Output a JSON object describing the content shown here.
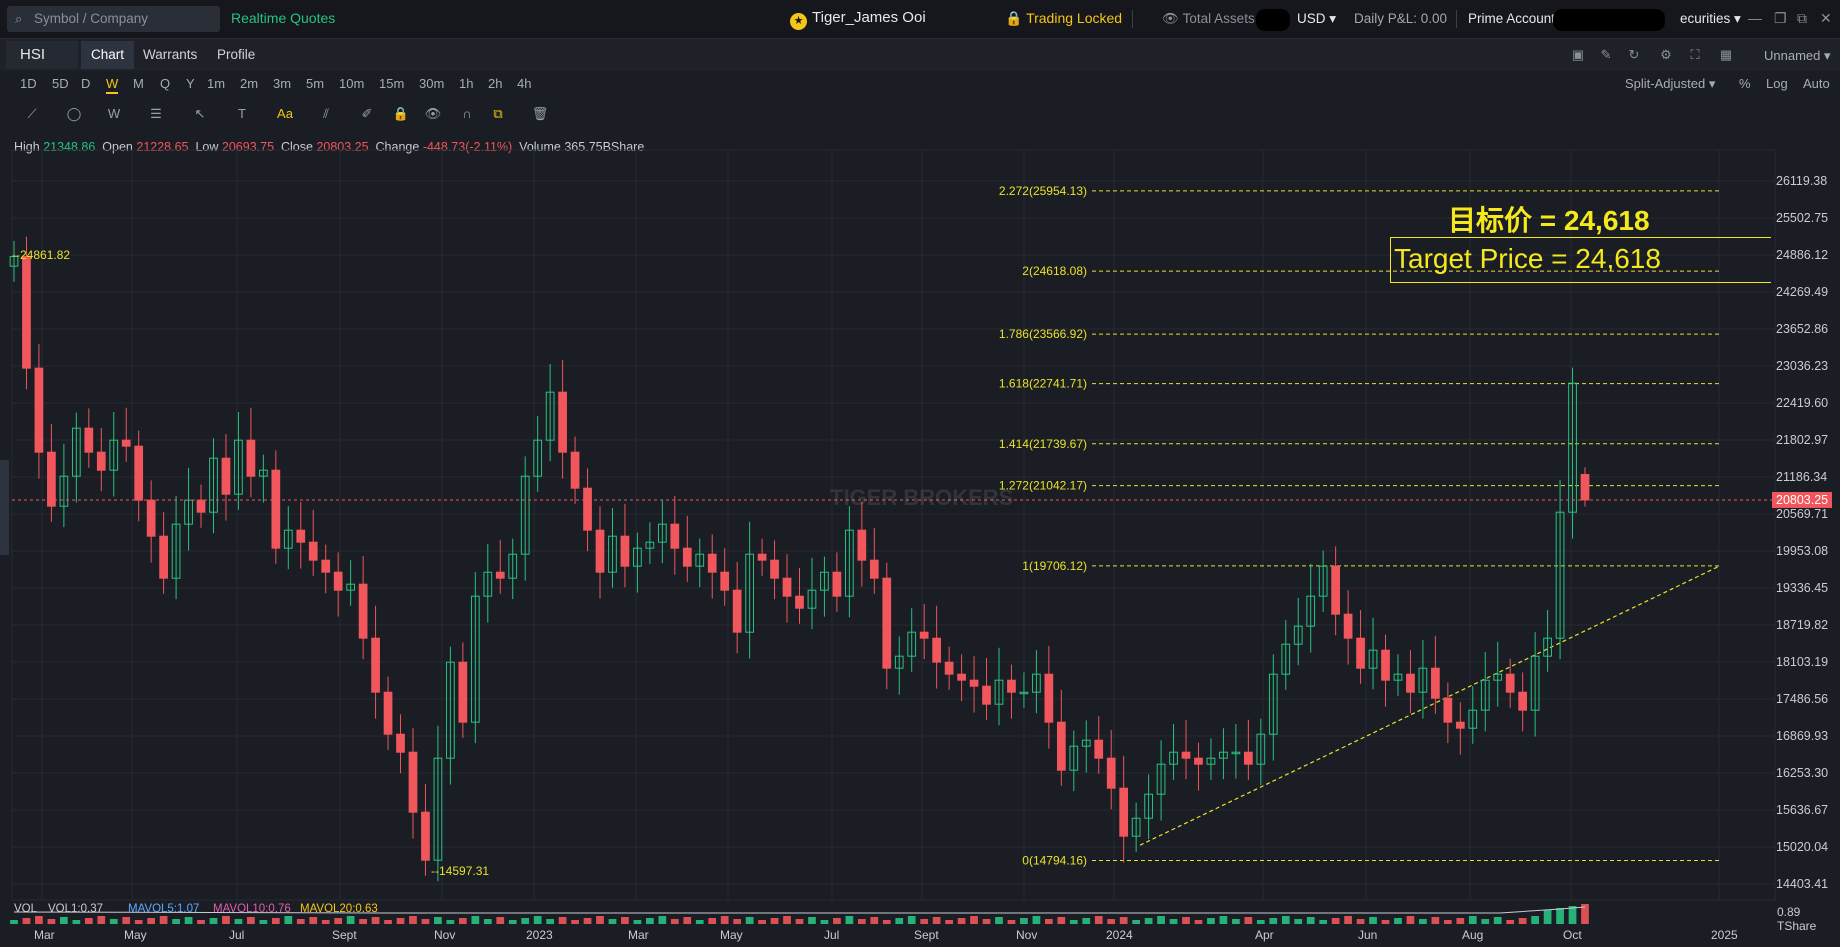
{
  "topbar": {
    "search_placeholder": "Symbol / Company",
    "realtime": "Realtime Quotes",
    "user": "Tiger_James Ooi",
    "trading_locked": "Trading Locked",
    "total_assets": "Total Assets",
    "currency": "USD",
    "daily_pnl": "Daily P&L: 0.00",
    "prime_account": "Prime Account",
    "securities": "ecurities"
  },
  "tabs": {
    "symbol": "HSI",
    "items": [
      "Chart",
      "Warrants",
      "Profile"
    ],
    "active": "Chart"
  },
  "right_tools": {
    "layout_name": "Unnamed"
  },
  "periods": {
    "items": [
      "1D",
      "5D",
      "D",
      "W",
      "M",
      "Q",
      "Y",
      "1m",
      "2m",
      "3m",
      "5m",
      "10m",
      "15m",
      "30m",
      "1h",
      "2h",
      "4h"
    ],
    "active": "W"
  },
  "chart_opts": {
    "adjust": "Split-Adjusted",
    "pct": "%",
    "log": "Log",
    "auto": "Auto"
  },
  "ohlc": {
    "high_label": "High",
    "high": "21348.86",
    "open_label": "Open",
    "open": "21228.65",
    "low_label": "Low",
    "low": "20693.75",
    "close_label": "Close",
    "close": "20803.25",
    "change_label": "Change",
    "change": "-448.73(-2.11%)",
    "volume_label": "Volume",
    "volume": "365.75BShare"
  },
  "annotations": {
    "target_cn": "目标价 = 24,618",
    "target_en": "Target Price = 24,618",
    "high_marker": "--24861.82",
    "low_marker": "--14597.31",
    "watermark": "TIGER BROKERS"
  },
  "chart_data": {
    "type": "candlestick",
    "price_axis": [
      "26119.38",
      "25502.75",
      "24886.12",
      "24269.49",
      "23652.86",
      "23036.23",
      "22419.60",
      "21802.97",
      "21186.34",
      "20569.71",
      "19953.08",
      "19336.45",
      "18719.82",
      "18103.19",
      "17486.56",
      "16869.93",
      "16253.30",
      "15636.67",
      "15020.04",
      "14403.41"
    ],
    "last_price": "20803.25",
    "time_axis": [
      "Mar",
      "May",
      "Jul",
      "Sept",
      "Nov",
      "2023",
      "Mar",
      "May",
      "Jul",
      "Sept",
      "Nov",
      "2024",
      "Apr",
      "Jun",
      "Aug",
      "Oct",
      "2025"
    ],
    "fib_levels": [
      {
        "label": "2.272(25954.13)",
        "value": 25954.13
      },
      {
        "label": "2(24618.08)",
        "value": 24618.08
      },
      {
        "label": "1.786(23566.92)",
        "value": 23566.92
      },
      {
        "label": "1.618(22741.71)",
        "value": 22741.71
      },
      {
        "label": "1.414(21739.67)",
        "value": 21739.67
      },
      {
        "label": "1.272(21042.17)",
        "value": 21042.17
      },
      {
        "label": "1(19706.12)",
        "value": 19706.12
      },
      {
        "label": "0(14794.16)",
        "value": 14794.16
      }
    ],
    "closes": [
      24861,
      23000,
      21600,
      20700,
      21200,
      22000,
      21600,
      21300,
      21800,
      21700,
      20800,
      20200,
      19500,
      20400,
      20800,
      20600,
      21500,
      20900,
      21800,
      21200,
      21300,
      20000,
      20300,
      20100,
      19800,
      19600,
      19300,
      19400,
      18500,
      17600,
      16900,
      16600,
      15600,
      14800,
      16500,
      18100,
      17100,
      19200,
      19600,
      19500,
      19900,
      21200,
      21800,
      22600,
      21600,
      21000,
      20300,
      19600,
      20200,
      19700,
      20000,
      20100,
      20400,
      20000,
      19700,
      19900,
      19600,
      19300,
      18600,
      19900,
      19800,
      19500,
      19200,
      19000,
      19300,
      19600,
      19200,
      20300,
      19800,
      19500,
      18000,
      18200,
      18600,
      18500,
      18100,
      17900,
      17800,
      17700,
      17400,
      17800,
      17600,
      17600,
      17900,
      17100,
      16300,
      16700,
      16800,
      16500,
      16000,
      15200,
      15500,
      15900,
      16400,
      16600,
      16500,
      16400,
      16500,
      16600,
      16600,
      16400,
      16900,
      17900,
      18400,
      18700,
      19200,
      19700,
      18900,
      18500,
      18000,
      18300,
      17800,
      17900,
      17600,
      18000,
      17500,
      17100,
      17000,
      17300,
      17800,
      17900,
      17600,
      17300,
      18200,
      18500,
      20600,
      22750,
      21000
    ],
    "opens": [
      24700,
      24861,
      23000,
      21600,
      20700,
      21200,
      22000,
      21600,
      21300,
      21800,
      21700,
      20800,
      20200,
      19500,
      20400,
      20800,
      20600,
      21500,
      20900,
      21800,
      21200,
      21300,
      20000,
      20300,
      20100,
      19800,
      19600,
      19300,
      19400,
      18500,
      17600,
      16900,
      16600,
      15600,
      14800,
      16500,
      18100,
      17100,
      19200,
      19600,
      19500,
      19900,
      21200,
      21800,
      22600,
      21600,
      21000,
      20300,
      19600,
      20200,
      19700,
      20000,
      20100,
      20400,
      20000,
      19700,
      19900,
      19600,
      19300,
      18600,
      19900,
      19800,
      19500,
      19200,
      19000,
      19300,
      19600,
      19200,
      20300,
      19800,
      19500,
      18000,
      18200,
      18600,
      18500,
      18100,
      17900,
      17800,
      17700,
      17400,
      17800,
      17600,
      17600,
      17900,
      17100,
      16300,
      16700,
      16800,
      16500,
      16000,
      15200,
      15500,
      15900,
      16400,
      16600,
      16500,
      16400,
      16500,
      16600,
      16600,
      16400,
      16900,
      17900,
      18400,
      18700,
      19200,
      19700,
      18900,
      18500,
      18000,
      18300,
      17800,
      17900,
      17600,
      18000,
      17500,
      17100,
      17000,
      17300,
      17800,
      17900,
      17600,
      17300,
      18200,
      18500,
      20600,
      22750
    ],
    "last_candle": {
      "open": 21228.65,
      "high": 21348.86,
      "low": 20693.75,
      "close": 20803.25
    },
    "volume_labels": {
      "vol": "VOL",
      "vol1": "VOL1:0.37",
      "mavol5": "MAVOL5:1.07",
      "mavol10": "MAVOL10:0.76",
      "mavol20": "MAVOL20:0.63",
      "axis_top": "0.89",
      "axis_unit": "TShare"
    }
  },
  "colors": {
    "up": "#27c281",
    "down": "#f0565b",
    "fib": "#e8e22a",
    "accent": "#f5c518",
    "bg": "#1a1d24"
  }
}
